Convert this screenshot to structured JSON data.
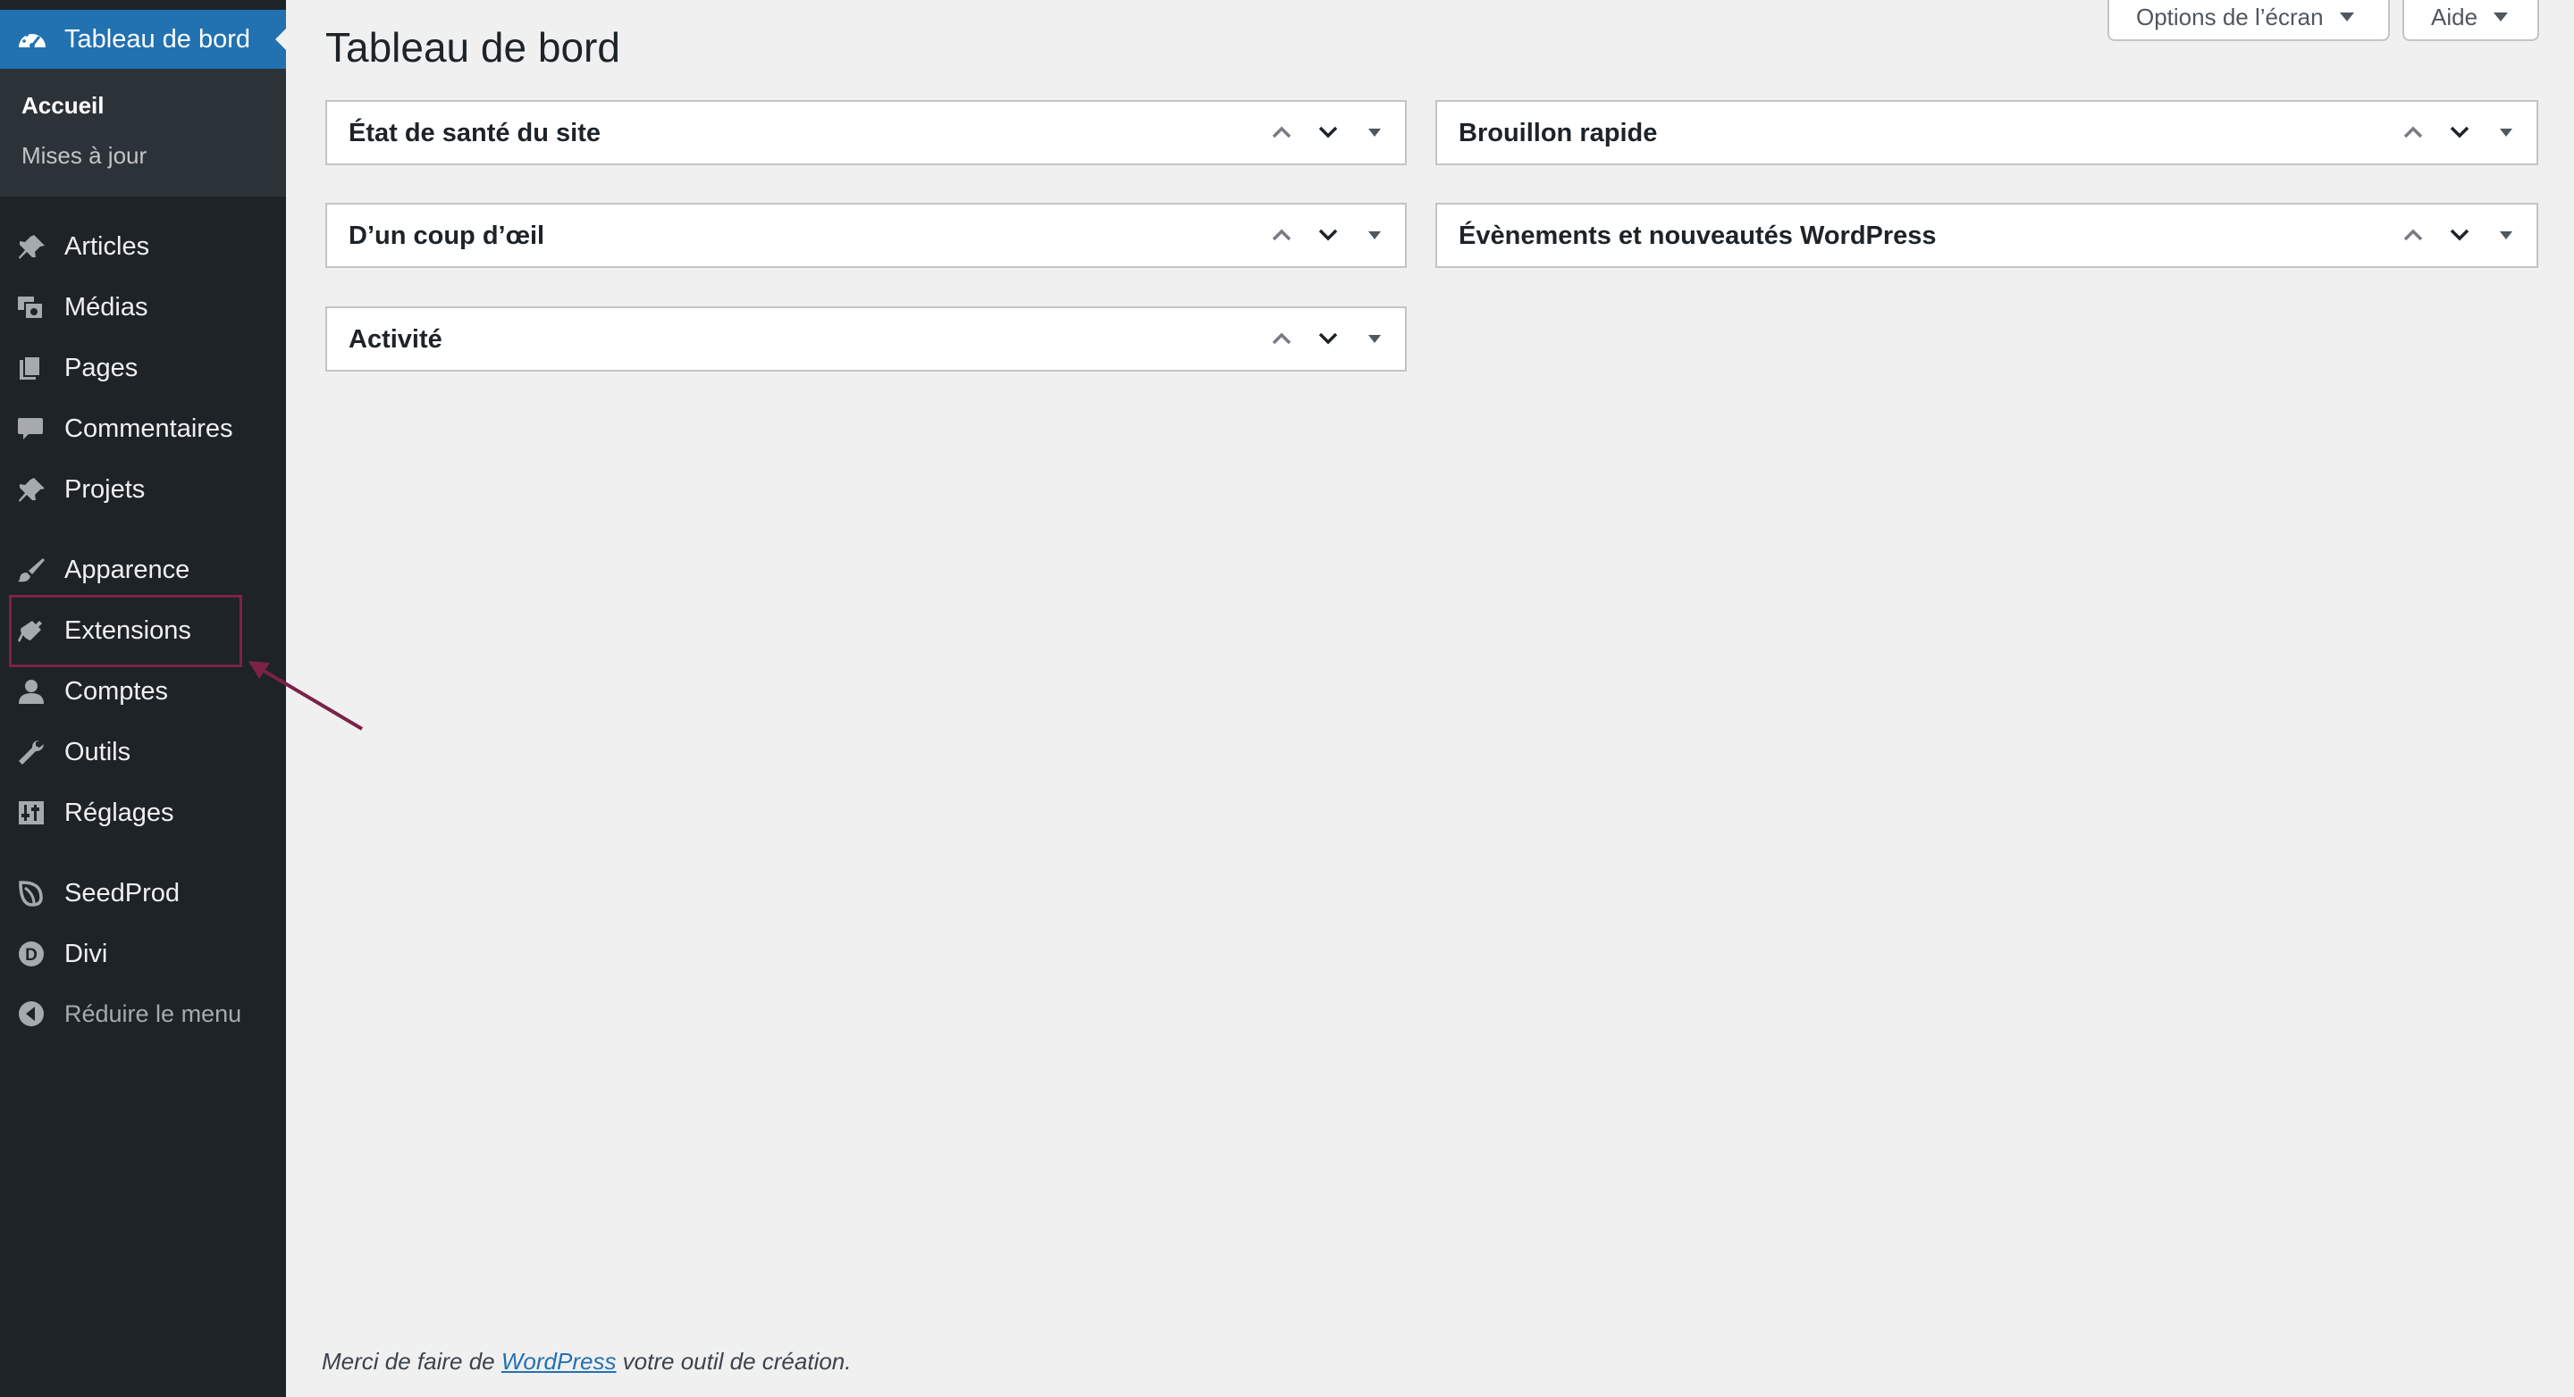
{
  "sidebar": {
    "active_item": {
      "label": "Tableau de bord",
      "icon": "dashboard-icon"
    },
    "submenu": [
      {
        "label": "Accueil",
        "current": true
      },
      {
        "label": "Mises à jour",
        "current": false
      }
    ],
    "items": [
      {
        "label": "Articles",
        "icon": "pin-icon"
      },
      {
        "label": "Médias",
        "icon": "media-icon"
      },
      {
        "label": "Pages",
        "icon": "pages-icon"
      },
      {
        "label": "Commentaires",
        "icon": "comment-icon"
      },
      {
        "label": "Projets",
        "icon": "pin-icon"
      },
      {
        "label": "Apparence",
        "icon": "brush-icon"
      },
      {
        "label": "Extensions",
        "icon": "plugin-icon"
      },
      {
        "label": "Comptes",
        "icon": "user-icon"
      },
      {
        "label": "Outils",
        "icon": "wrench-icon"
      },
      {
        "label": "Réglages",
        "icon": "settings-icon"
      },
      {
        "label": "SeedProd",
        "icon": "seedprod-icon"
      },
      {
        "label": "Divi",
        "icon": "divi-icon"
      }
    ],
    "collapse_label": "Réduire le menu",
    "highlighted_item": "Extensions"
  },
  "header": {
    "title": "Tableau de bord",
    "screen_options_label": "Options de l’écran",
    "help_label": "Aide"
  },
  "widgets": {
    "left": [
      {
        "title": "État de santé du site"
      },
      {
        "title": "D’un coup d’œil"
      },
      {
        "title": "Activité"
      }
    ],
    "right": [
      {
        "title": "Brouillon rapide"
      },
      {
        "title": "Évènements et nouveautés WordPress"
      }
    ]
  },
  "footer": {
    "prefix": "Merci de faire de ",
    "link_text": "WordPress",
    "suffix": " votre outil de création."
  },
  "colors": {
    "sidebar_bg": "#1d2327",
    "submenu_bg": "#2c3338",
    "accent": "#2271b1",
    "page_bg": "#f0f0f1",
    "annotation": "#7b2248"
  }
}
